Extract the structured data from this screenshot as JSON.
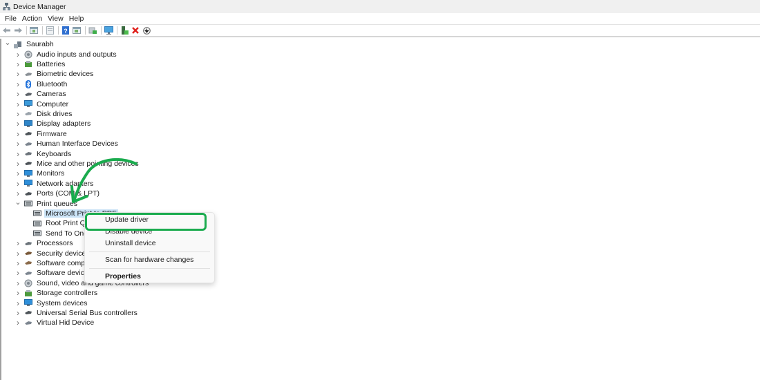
{
  "window": {
    "title": "Device Manager",
    "app_icon": "device-manager-icon"
  },
  "menubar": {
    "items": [
      "File",
      "Action",
      "View",
      "Help"
    ]
  },
  "toolbar": {
    "buttons": [
      {
        "name": "back-button",
        "icon": "arrow-left-icon",
        "glyph": "⬅"
      },
      {
        "name": "forward-button",
        "icon": "arrow-right-icon",
        "glyph": "➡"
      },
      {
        "name": "show-hide-console-tree-button",
        "icon": "console-tree-icon",
        "glyph": "▭"
      },
      {
        "name": "properties-button",
        "icon": "properties-icon",
        "glyph": "▤"
      },
      {
        "name": "help-button",
        "icon": "help-icon",
        "glyph": "?"
      },
      {
        "name": "action-pane-button",
        "icon": "action-pane-icon",
        "glyph": "▭"
      },
      {
        "name": "update-driver-button",
        "icon": "update-driver-icon",
        "glyph": "⇪"
      },
      {
        "name": "scan-hardware-button",
        "icon": "monitor-scan-icon",
        "glyph": "▭"
      },
      {
        "name": "add-legacy-hardware-button",
        "icon": "add-hardware-icon",
        "glyph": "▙"
      },
      {
        "name": "uninstall-device-button",
        "icon": "red-x-icon",
        "glyph": "✕"
      },
      {
        "name": "disable-device-button",
        "icon": "download-circle-icon",
        "glyph": "⬇"
      }
    ]
  },
  "tree": {
    "root": {
      "label": "Saurabh",
      "icon": "computer-root-icon",
      "expanded": true
    },
    "categories": [
      {
        "label": "Audio inputs and outputs",
        "icon": "speaker-icon",
        "expanded": false
      },
      {
        "label": "Batteries",
        "icon": "battery-icon",
        "expanded": false
      },
      {
        "label": "Biometric devices",
        "icon": "biometric-icon",
        "expanded": false
      },
      {
        "label": "Bluetooth",
        "icon": "bluetooth-icon",
        "expanded": false
      },
      {
        "label": "Cameras",
        "icon": "camera-icon",
        "expanded": false
      },
      {
        "label": "Computer",
        "icon": "computer-icon",
        "expanded": false
      },
      {
        "label": "Disk drives",
        "icon": "disk-drive-icon",
        "expanded": false
      },
      {
        "label": "Display adapters",
        "icon": "display-adapter-icon",
        "expanded": false
      },
      {
        "label": "Firmware",
        "icon": "firmware-icon",
        "expanded": false
      },
      {
        "label": "Human Interface Devices",
        "icon": "hid-icon",
        "expanded": false
      },
      {
        "label": "Keyboards",
        "icon": "keyboard-icon",
        "expanded": false
      },
      {
        "label": "Mice and other pointing devices",
        "icon": "mouse-icon",
        "expanded": false
      },
      {
        "label": "Monitors",
        "icon": "monitor-icon",
        "expanded": false
      },
      {
        "label": "Network adapters",
        "icon": "network-adapter-icon",
        "expanded": false
      },
      {
        "label": "Ports (COM & LPT)",
        "icon": "port-icon",
        "expanded": false
      },
      {
        "label": "Print queues",
        "icon": "printer-icon",
        "expanded": true,
        "children": [
          {
            "label": "Microsoft Print to PDF",
            "icon": "printer-icon",
            "selected": true
          },
          {
            "label": "Root Print Queue",
            "icon": "printer-icon",
            "selected": false
          },
          {
            "label": "Send To OneNote",
            "icon": "printer-icon",
            "selected": false
          }
        ]
      },
      {
        "label": "Processors",
        "icon": "processor-icon",
        "expanded": false
      },
      {
        "label": "Security devices",
        "icon": "security-device-icon",
        "expanded": false
      },
      {
        "label": "Software components",
        "icon": "software-component-icon",
        "expanded": false
      },
      {
        "label": "Software devices",
        "icon": "software-device-icon",
        "expanded": false
      },
      {
        "label": "Sound, video and game controllers",
        "icon": "sound-controller-icon",
        "expanded": false
      },
      {
        "label": "Storage controllers",
        "icon": "storage-controller-icon",
        "expanded": false
      },
      {
        "label": "System devices",
        "icon": "system-device-icon",
        "expanded": false
      },
      {
        "label": "Universal Serial Bus controllers",
        "icon": "usb-icon",
        "expanded": false
      },
      {
        "label": "Virtual Hid Device",
        "icon": "hid-icon",
        "expanded": false
      }
    ]
  },
  "context_menu": {
    "items": [
      {
        "label": "Update driver",
        "bold": false,
        "highlighted": true
      },
      {
        "label": "Disable device",
        "bold": false
      },
      {
        "label": "Uninstall device",
        "bold": false
      },
      {
        "separator": true
      },
      {
        "label": "Scan for hardware changes",
        "bold": false
      },
      {
        "separator": true
      },
      {
        "label": "Properties",
        "bold": true
      }
    ]
  },
  "annotation": {
    "highlight_color": "#1aab4e",
    "arrow_color": "#1aab4e",
    "highlighted_item": "Update driver"
  },
  "colors": {
    "selection": "#cce4f7",
    "titlebar": "#f0f0f0",
    "menu_bg": "#f9f9f9"
  }
}
